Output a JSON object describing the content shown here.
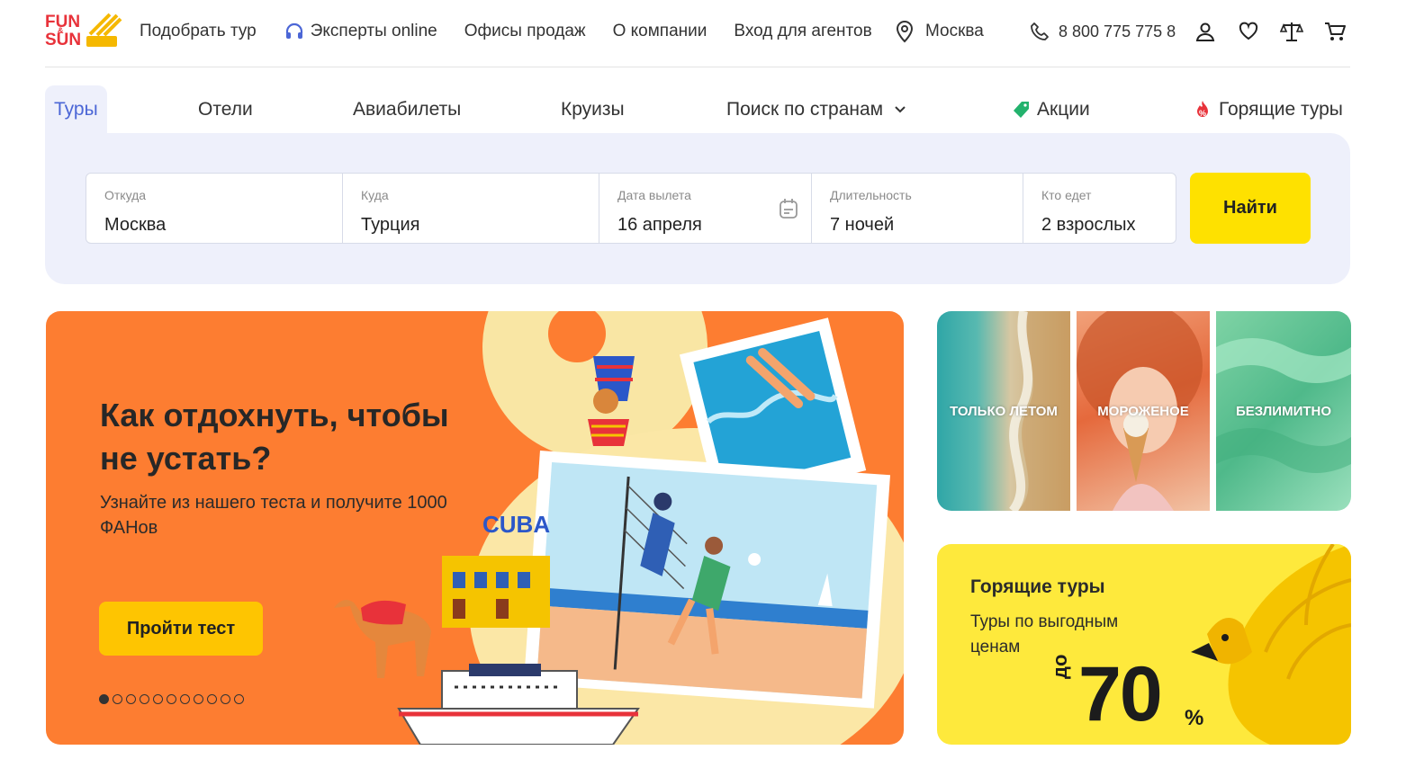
{
  "header": {
    "logo_top": "FUN",
    "logo_amp": "&",
    "logo_bottom": "SUN",
    "nav": {
      "pick_tour": "Подобрать тур",
      "experts": "Эксперты online",
      "offices": "Офисы продаж",
      "about": "О компании",
      "agents": "Вход для агентов"
    },
    "city": "Москва",
    "phone": "8 800 775 775 8",
    "icons": [
      "user-icon",
      "heart-icon",
      "scales-icon",
      "cart-icon"
    ]
  },
  "tabs": {
    "tours": "Туры",
    "hotels": "Отели",
    "flights": "Авиабилеты",
    "cruises": "Круизы",
    "countries": "Поиск по странам",
    "deals": "Акции",
    "hot": "Горящие туры"
  },
  "search": {
    "from": {
      "label": "Откуда",
      "value": "Москва"
    },
    "to": {
      "label": "Куда",
      "value": "Турция"
    },
    "date": {
      "label": "Дата вылета",
      "value": "16 апреля"
    },
    "duration": {
      "label": "Длительность",
      "value": "7 ночей"
    },
    "who": {
      "label": "Кто едет",
      "value": "2 взрослых"
    },
    "button": "Найти"
  },
  "hero": {
    "title": "Как отдохнуть, чтобы не устать?",
    "subtitle": "Узнайте из нашего теста и получите 1000 ФАНов",
    "button": "Пройти тест",
    "slides_total": 11,
    "slide_active": 1,
    "art_text": "CUBA"
  },
  "promos": [
    {
      "label": "ТОЛЬКО ЛЕТОМ"
    },
    {
      "label": "МОРОЖЕНОЕ"
    },
    {
      "label": "БЕЗЛИМИТНО"
    }
  ],
  "hot": {
    "title": "Горящие туры",
    "subtitle": "Туры по выгодным ценам",
    "upto": "до",
    "discount": "70",
    "percent": "%"
  },
  "colors": {
    "accent_blue": "#4b66d6",
    "search_bg": "#eef0fb",
    "find_button": "#fee100",
    "hero_bg": "#fd7d31",
    "hero_button": "#fec501",
    "hot_bg": "#fee93c",
    "brand_red": "#e8323a"
  }
}
